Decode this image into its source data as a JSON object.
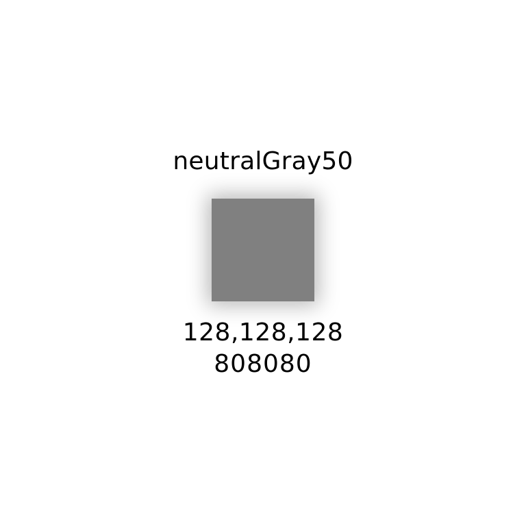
{
  "color": {
    "name": "neutralGray50",
    "rgb": "128,128,128",
    "hex": "808080",
    "swatch_color": "#808080"
  }
}
